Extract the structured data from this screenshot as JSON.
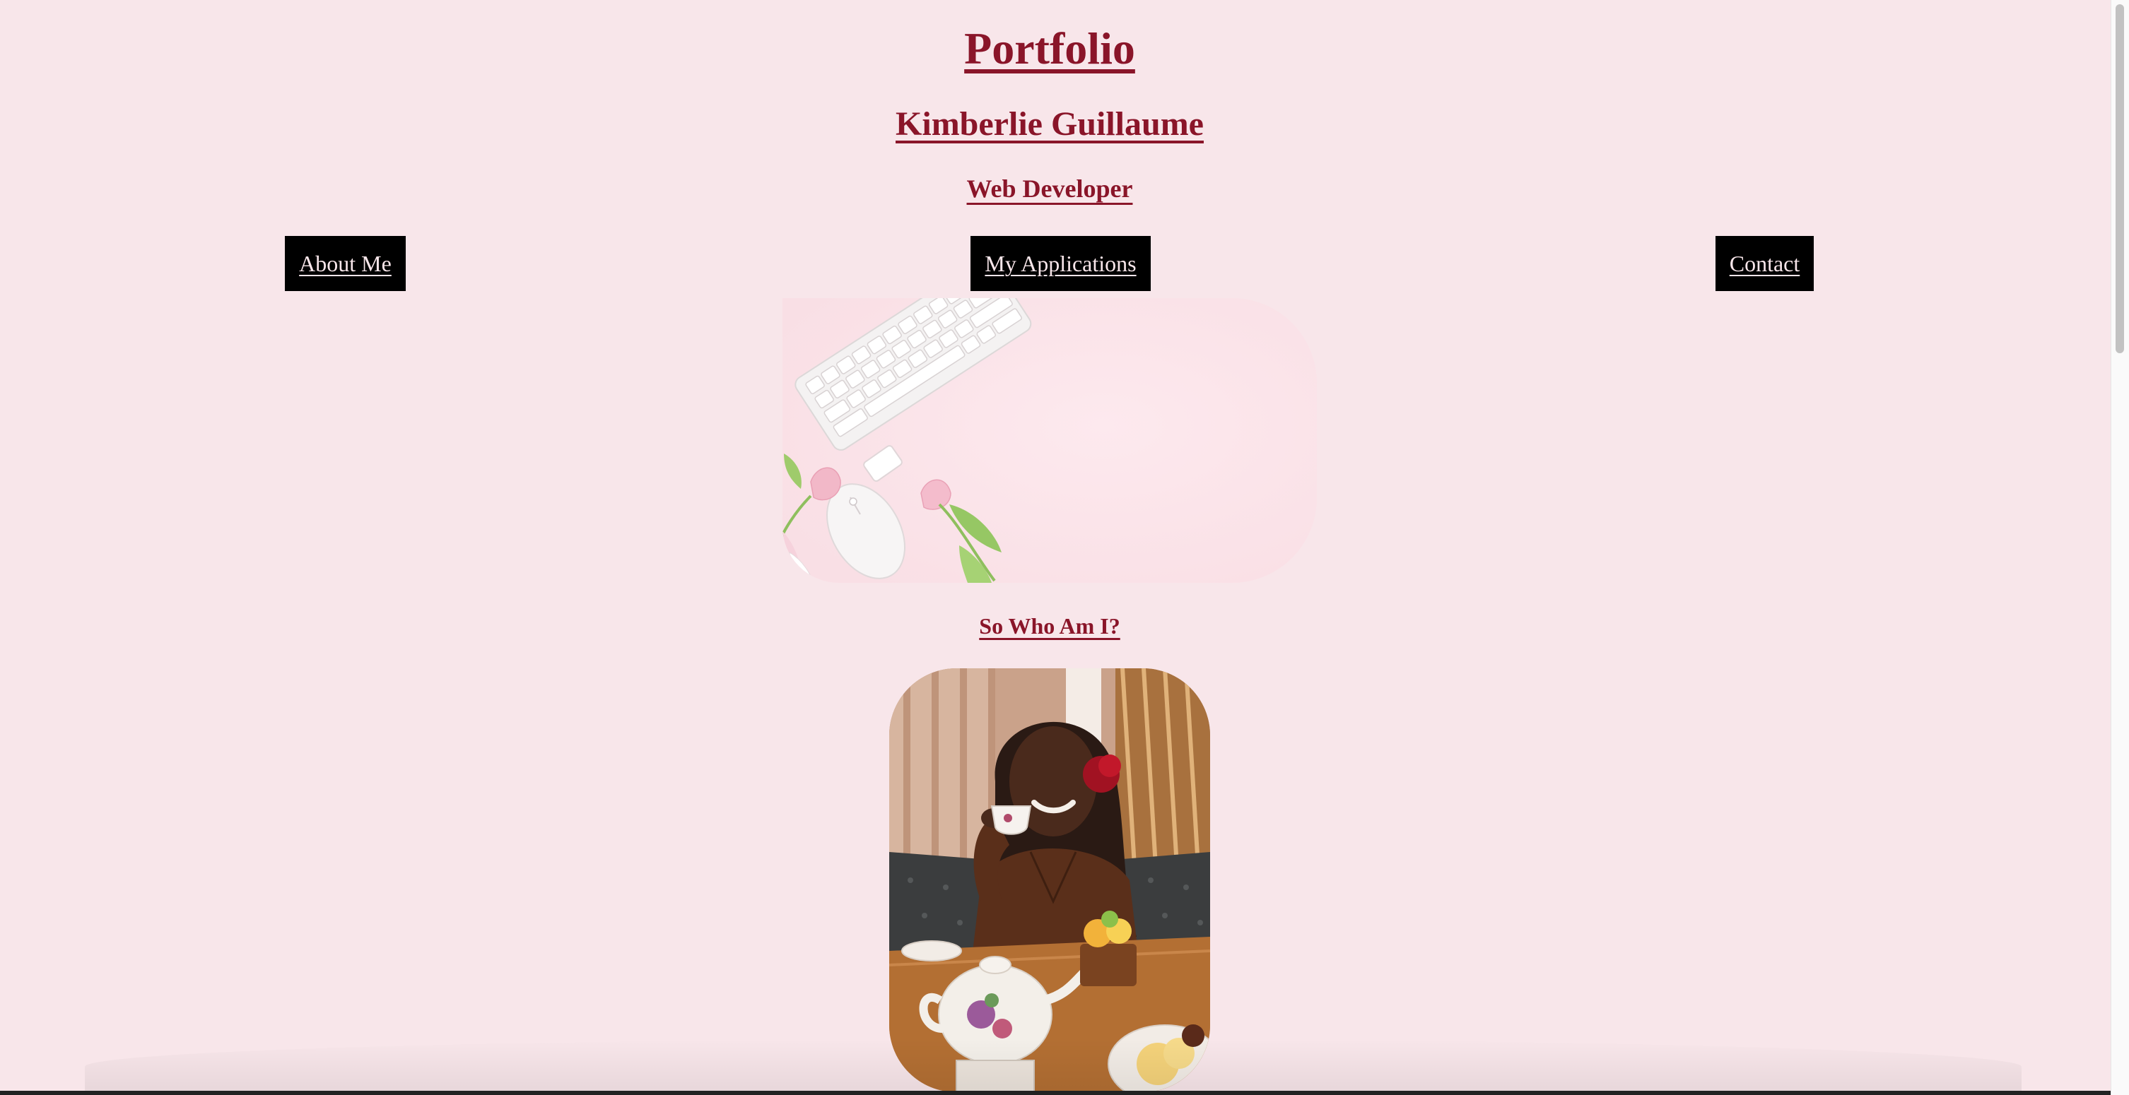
{
  "header": {
    "title": "Portfolio",
    "name": "Kimberlie Guillaume",
    "role": "Web Developer"
  },
  "nav": {
    "about": "About Me",
    "applications": "My Applications",
    "contact": "Contact"
  },
  "about": {
    "heading": "So Who Am I?"
  },
  "colors": {
    "background": "#f8e6ea",
    "accent": "#8a1529",
    "nav_bg": "#000000"
  },
  "icons": {
    "hero": "desk-keyboard-tulips-image",
    "portrait": "profile-photo"
  }
}
